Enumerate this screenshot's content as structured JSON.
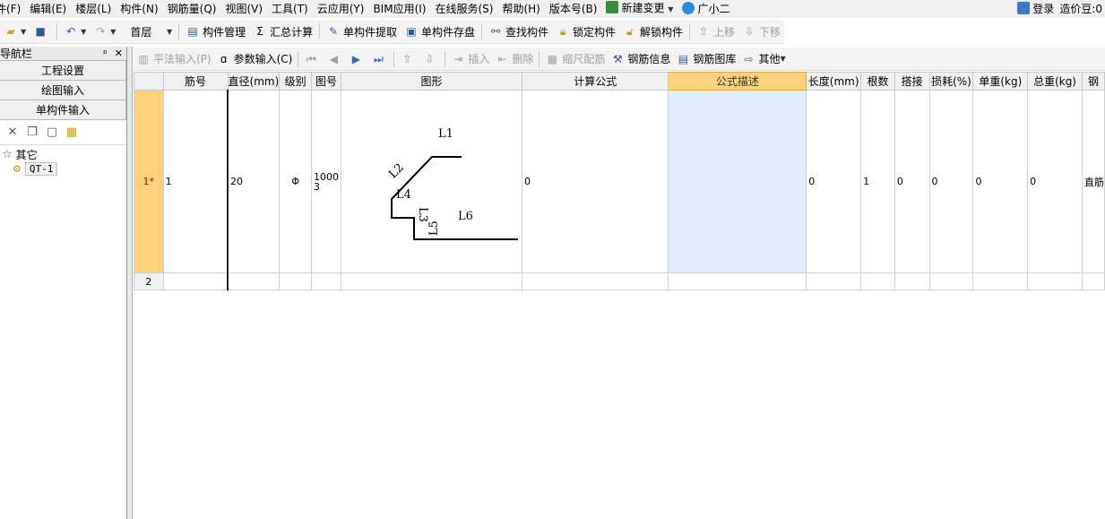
{
  "menu": {
    "items": [
      "件(F)",
      "编辑(E)",
      "楼层(L)",
      "构件(N)",
      "钢筋量(Q)",
      "视图(V)",
      "工具(T)",
      "云应用(Y)",
      "BIM应用(I)",
      "在线服务(S)",
      "帮助(H)",
      "版本号(B)"
    ],
    "new_change": "新建变更",
    "assistant": "广小二",
    "login": "登录",
    "credit": "造价豆:0"
  },
  "toolbar1": {
    "floor": "首层",
    "component_manage": "构件管理",
    "sum_symbol": "Σ",
    "sum_calc": "汇总计算",
    "extract": "单构件提取",
    "save_disk": "单构件存盘",
    "find": "查找构件",
    "lock": "锁定构件",
    "unlock": "解锁构件",
    "move_up": "上移",
    "move_down": "下移"
  },
  "nav": {
    "title": "导航栏",
    "pin": "ᵖ",
    "close": "✕",
    "buttons": [
      "工程设置",
      "绘图输入",
      "单构件输入"
    ],
    "tree_root": "其它",
    "tree_child": "QT-1"
  },
  "toolbar2": {
    "flat_input": "平法输入(P)",
    "param_input": "参数输入(C)",
    "insert": "插入",
    "delete": "删除",
    "scale": "缩尺配筋",
    "rebar_info": "钢筋信息",
    "rebar_lib": "钢筋图库",
    "other": "其他"
  },
  "table": {
    "headers": [
      "",
      "筋号",
      "直径(mm)",
      "级别",
      "图号",
      "图形",
      "计算公式",
      "公式描述",
      "长度(mm)",
      "根数",
      "搭接",
      "损耗(%)",
      "单重(kg)",
      "总重(kg)",
      "钢"
    ],
    "rows": [
      {
        "row": "1*",
        "bar_no": "1",
        "diameter": "20",
        "grade": "Φ",
        "fig_no_1": "1000",
        "fig_no_2": "3",
        "formula": "0",
        "desc": "",
        "length": "0",
        "count": "1",
        "lap": "0",
        "loss": "0",
        "unit_w": "0",
        "total_w": "0",
        "type": "直筋"
      },
      {
        "row": "2",
        "bar_no": "",
        "diameter": "",
        "grade": "",
        "fig_no_1": "",
        "fig_no_2": "",
        "formula": "",
        "desc": "",
        "length": "",
        "count": "",
        "lap": "",
        "loss": "",
        "unit_w": "",
        "total_w": "",
        "type": ""
      }
    ],
    "shape_labels": {
      "l1": "L1",
      "l2": "L2",
      "l3": "L3",
      "l4": "L4",
      "l5": "L5",
      "l6": "L6"
    }
  },
  "colors": {
    "header_highlight": "#fcd37c",
    "selected_cell": "#e0eefc",
    "active_row_text": "#c00000"
  }
}
